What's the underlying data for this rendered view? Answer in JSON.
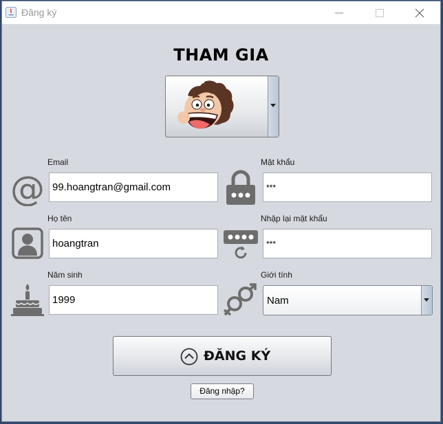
{
  "window": {
    "title": "Đăng ký"
  },
  "heading": "THAM GIA",
  "form": {
    "email": {
      "label": "Email",
      "value": "99.hoangtran@gmail.com"
    },
    "password": {
      "label": "Mật khẩu",
      "value": "***"
    },
    "fullname": {
      "label": "Họ tên",
      "value": "hoangtran"
    },
    "confirm_password": {
      "label": "Nhập lại mật khẩu",
      "value": "***"
    },
    "birth_year": {
      "label": "Năm sinh",
      "value": "1999"
    },
    "gender": {
      "label": "Giới tính",
      "value": "Nam"
    }
  },
  "buttons": {
    "register": "ĐĂNG KÝ",
    "login": "Đăng nhập?"
  },
  "icons": {
    "email": "at-sign-icon",
    "password": "padlock-icon",
    "fullname": "user-icon",
    "confirm_password": "password-reset-icon",
    "birth_year": "birthday-cake-icon",
    "gender": "gender-icon"
  },
  "colors": {
    "window_bg": "#d6d9df",
    "icon_gray": "#6d6d6d"
  }
}
